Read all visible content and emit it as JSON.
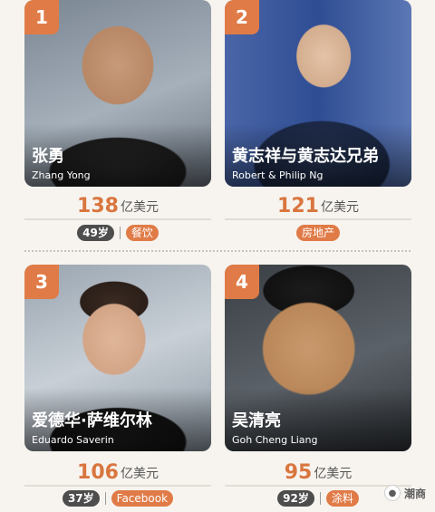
{
  "entries": [
    {
      "rank": "1",
      "name_cn": "张勇",
      "name_en": "Zhang Yong",
      "worth_num": "138",
      "worth_unit": "亿美元",
      "age": "49岁",
      "industry": "餐饮"
    },
    {
      "rank": "2",
      "name_cn": "黄志祥与黄志达兄弟",
      "name_en": "Robert & Philip Ng",
      "worth_num": "121",
      "worth_unit": "亿美元",
      "age": "",
      "industry": "房地产"
    },
    {
      "rank": "3",
      "name_cn": "爱德华·萨维尔林",
      "name_en": "Eduardo Saverin",
      "worth_num": "106",
      "worth_unit": "亿美元",
      "age": "37岁",
      "industry": "Facebook"
    },
    {
      "rank": "4",
      "name_cn": "吴清亮",
      "name_en": "Goh Cheng Liang",
      "worth_num": "95",
      "worth_unit": "亿美元",
      "age": "92岁",
      "industry": "涂料"
    }
  ],
  "watermark": {
    "icon": "wechat-logo-icon",
    "text": "潮商"
  },
  "colors": {
    "accent": "#e07b47",
    "age_pill": "#4d4d4d",
    "background": "#f7f4ef"
  }
}
